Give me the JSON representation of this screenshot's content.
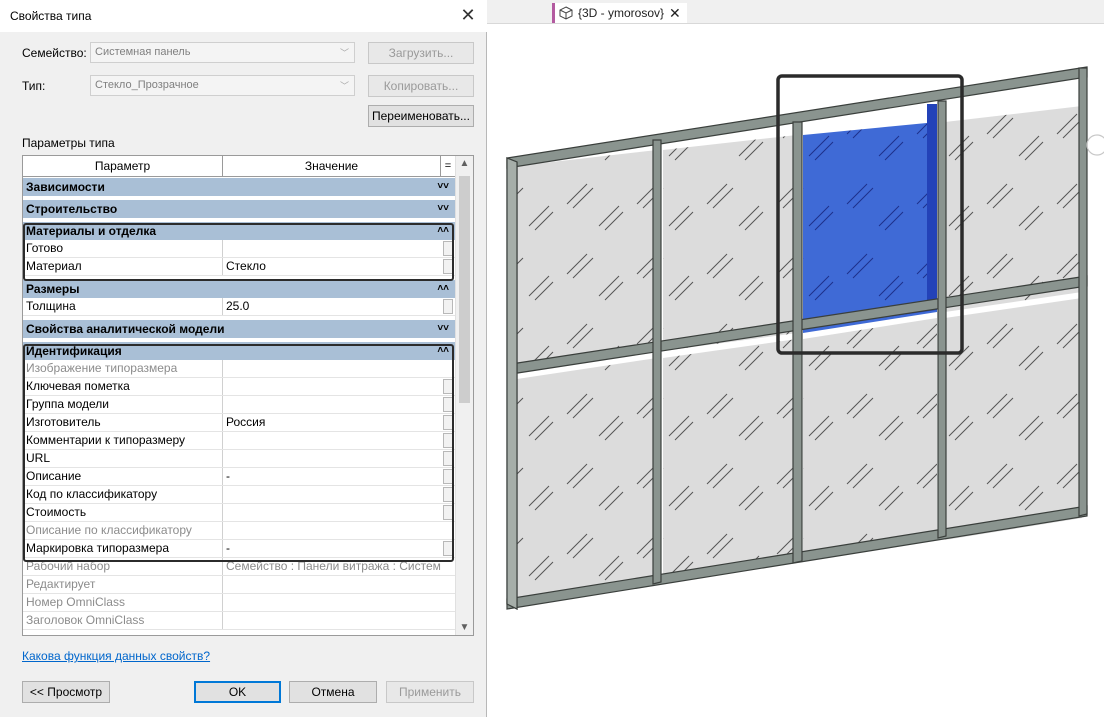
{
  "dialog": {
    "title": "Свойства типа",
    "family_label": "Семейство:",
    "family_value": "Системная панель",
    "type_label": "Тип:",
    "type_value": "Стекло_Прозрачное",
    "load_button": "Загрузить...",
    "copy_button": "Копировать...",
    "rename_button": "Переименовать...",
    "params_label": "Параметры типа",
    "columns": {
      "param": "Параметр",
      "value": "Значение",
      "eq": "="
    },
    "groups": [
      {
        "label": "Зависимости",
        "expanded": false,
        "rows": []
      },
      {
        "label": "Строительство",
        "expanded": false,
        "rows": []
      },
      {
        "label": "Материалы и отделка",
        "expanded": true,
        "rows": [
          {
            "key": "Готово",
            "value": "",
            "gray": false
          },
          {
            "key": "Материал",
            "value": "Стекло",
            "gray": false
          }
        ]
      },
      {
        "label": "Размеры",
        "expanded": true,
        "rows": [
          {
            "key": "Толщина",
            "value": "25.0",
            "gray": false
          }
        ]
      },
      {
        "label": "Свойства аналитической модели",
        "expanded": false,
        "rows": []
      },
      {
        "label": "Идентификация",
        "expanded": true,
        "rows": [
          {
            "key": "Изображение типоразмера",
            "value": "",
            "gray": true
          },
          {
            "key": "Ключевая пометка",
            "value": "",
            "gray": false
          },
          {
            "key": "Группа модели",
            "value": "",
            "gray": false
          },
          {
            "key": "Изготовитель",
            "value": "Россия",
            "gray": false
          },
          {
            "key": "Комментарии к типоразмеру",
            "value": "",
            "gray": false
          },
          {
            "key": "URL",
            "value": "",
            "gray": false
          },
          {
            "key": "Описание",
            "value": "-",
            "gray": false
          },
          {
            "key": "Код по классификатору",
            "value": "",
            "gray": false
          },
          {
            "key": "Стоимость",
            "value": "",
            "gray": false
          },
          {
            "key": "Описание по классификатору",
            "value": "",
            "gray": true
          },
          {
            "key": "Маркировка типоразмера",
            "value": "-",
            "gray": false
          },
          {
            "key": "Рабочий набор",
            "value": "Семейство  : Панели витража : Систем",
            "gray": true
          },
          {
            "key": "Редактирует",
            "value": "",
            "gray": true
          },
          {
            "key": "Номер OmniClass",
            "value": "",
            "gray": true
          },
          {
            "key": "Заголовок OmniClass",
            "value": "",
            "gray": true
          }
        ]
      }
    ],
    "help_link": "Какова функция данных свойств?",
    "preview_button": "<< Просмотр",
    "ok_button": "OK",
    "cancel_button": "Отмена",
    "apply_button": "Применить"
  },
  "view": {
    "tab_label": "{3D - ymorosov}"
  },
  "colors": {
    "group_header": "#a9bfd6",
    "selected_panel": "#3a64d4",
    "frame": "#7f8b86"
  }
}
